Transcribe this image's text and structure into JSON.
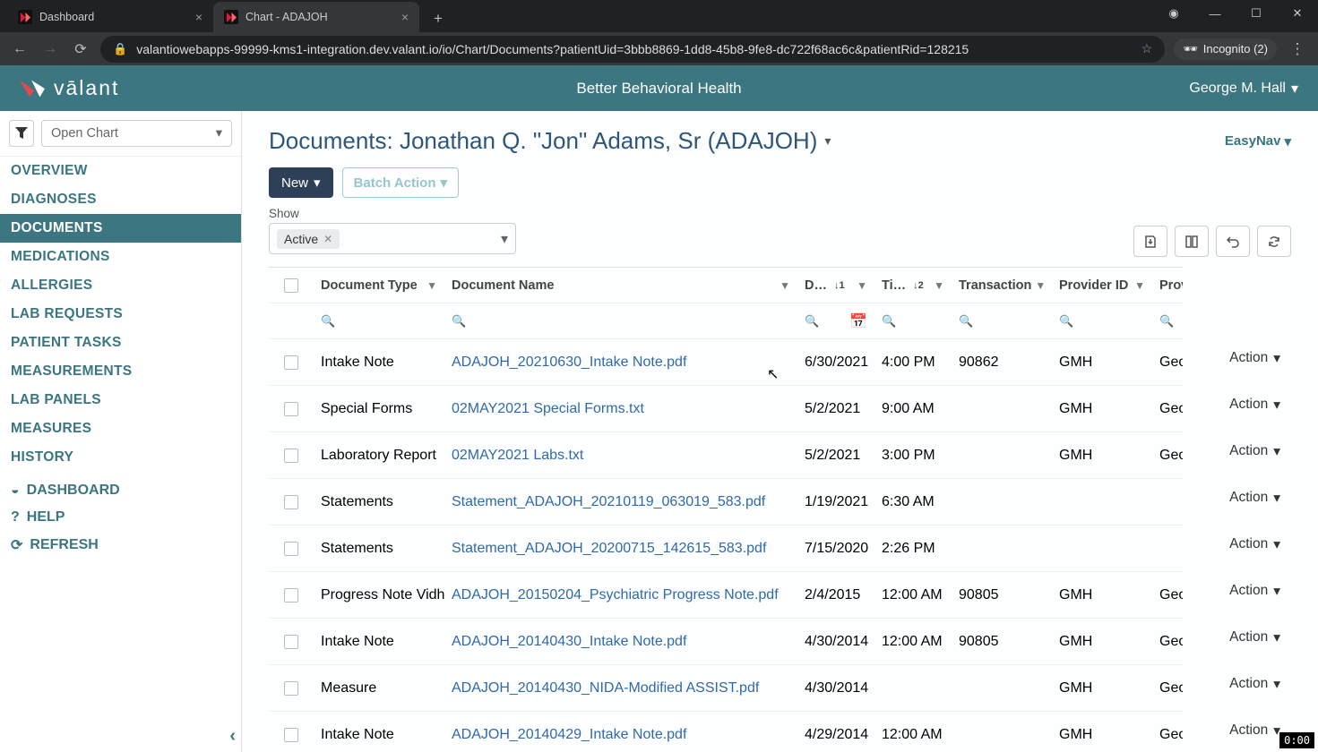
{
  "browser": {
    "tabs": [
      {
        "title": "Dashboard",
        "active": false
      },
      {
        "title": "Chart - ADAJOH",
        "active": true
      }
    ],
    "url": "valantiowebapps-99999-kms1-integration.dev.valant.io/io/Chart/Documents?patientUid=3bbb8869-1dd8-45b8-9fe8-dc722f68ac6c&patientRid=128215",
    "incognito_label": "Incognito (2)"
  },
  "header": {
    "brand": "vālant",
    "org": "Better Behavioral Health",
    "user": "George M. Hall"
  },
  "sidebar": {
    "open_chart": "Open Chart",
    "items": [
      "OVERVIEW",
      "DIAGNOSES",
      "DOCUMENTS",
      "MEDICATIONS",
      "ALLERGIES",
      "LAB REQUESTS",
      "PATIENT TASKS",
      "MEASUREMENTS",
      "LAB PANELS",
      "MEASURES",
      "HISTORY"
    ],
    "active_index": 2,
    "sec2": [
      {
        "icon": "dashboard",
        "label": "DASHBOARD"
      },
      {
        "icon": "help",
        "label": "HELP"
      },
      {
        "icon": "refresh",
        "label": "REFRESH"
      }
    ]
  },
  "page": {
    "title": "Documents: Jonathan Q. \"Jon\" Adams, Sr (ADAJOH)",
    "easy_nav": "EasyNav",
    "new_label": "New",
    "batch_label": "Batch Action",
    "show_label": "Show",
    "filter_chip": "Active"
  },
  "columns": [
    "",
    "Document Type",
    "Document Name",
    "D…",
    "Ti…",
    "Transaction",
    "Provider ID",
    "Prov"
  ],
  "sorts": {
    "date": "↓1",
    "time": "↓2"
  },
  "rows": [
    {
      "type": "Intake Note",
      "name": "ADAJOH_20210630_Intake Note.pdf",
      "date": "6/30/2021",
      "time": "4:00 PM",
      "trans": "90862",
      "prov": "GMH",
      "prov2": "Geo"
    },
    {
      "type": "Special Forms",
      "name": "02MAY2021 Special Forms.txt",
      "date": "5/2/2021",
      "time": "9:00 AM",
      "trans": "",
      "prov": "GMH",
      "prov2": "Geo"
    },
    {
      "type": "Laboratory Report",
      "name": "02MAY2021 Labs.txt",
      "date": "5/2/2021",
      "time": "3:00 PM",
      "trans": "",
      "prov": "GMH",
      "prov2": "Geo"
    },
    {
      "type": "Statements",
      "name": "Statement_ADAJOH_20210119_063019_583.pdf",
      "date": "1/19/2021",
      "time": "6:30 AM",
      "trans": "",
      "prov": "",
      "prov2": ""
    },
    {
      "type": "Statements",
      "name": "Statement_ADAJOH_20200715_142615_583.pdf",
      "date": "7/15/2020",
      "time": "2:26 PM",
      "trans": "",
      "prov": "",
      "prov2": ""
    },
    {
      "type": "Progress Note Vidhya",
      "name": "ADAJOH_20150204_Psychiatric Progress Note.pdf",
      "date": "2/4/2015",
      "time": "12:00 AM",
      "trans": "90805",
      "prov": "GMH",
      "prov2": "Geo"
    },
    {
      "type": "Intake Note",
      "name": "ADAJOH_20140430_Intake Note.pdf",
      "date": "4/30/2014",
      "time": "12:00 AM",
      "trans": "90805",
      "prov": "GMH",
      "prov2": "Geo"
    },
    {
      "type": "Measure",
      "name": "ADAJOH_20140430_NIDA-Modified ASSIST.pdf",
      "date": "4/30/2014",
      "time": "",
      "trans": "",
      "prov": "GMH",
      "prov2": "Geo"
    },
    {
      "type": "Intake Note",
      "name": "ADAJOH_20140429_Intake Note.pdf",
      "date": "4/29/2014",
      "time": "12:00 AM",
      "trans": "",
      "prov": "GMH",
      "prov2": "Geo"
    }
  ],
  "action_label": "Action",
  "timer": "0:00"
}
